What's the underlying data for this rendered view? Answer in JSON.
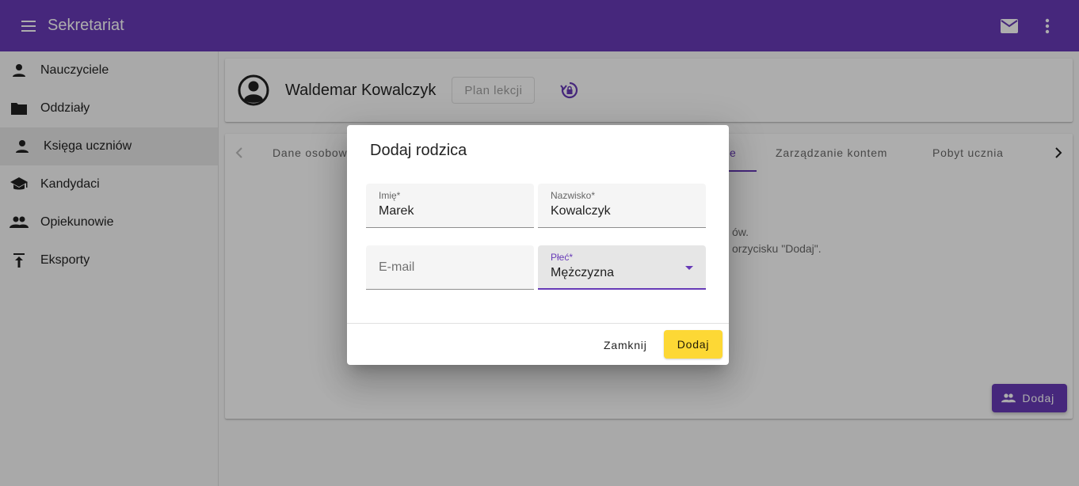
{
  "app": {
    "title": "Sekretariat"
  },
  "colors": {
    "primary": "#673ab7",
    "accent": "#fdd835"
  },
  "sidebar": {
    "items": [
      {
        "label": "Nauczyciele",
        "icon": "person-icon"
      },
      {
        "label": "Oddziały",
        "icon": "folder-icon"
      },
      {
        "label": "Księga uczniów",
        "icon": "person-icon",
        "active": true
      },
      {
        "label": "Kandydaci",
        "icon": "school-icon"
      },
      {
        "label": "Opiekunowie",
        "icon": "people-icon"
      },
      {
        "label": "Eksporty",
        "icon": "upload-icon"
      }
    ]
  },
  "profile": {
    "name": "Waldemar Kowalczyk",
    "plan_button": "Plan lekcji"
  },
  "tabs": {
    "items": [
      {
        "label": "Dane osobow"
      },
      {
        "label": "e",
        "active": true
      },
      {
        "label": "Zarządzanie kontem"
      },
      {
        "label": "Pobyt ucznia"
      }
    ],
    "content_lines": [
      "ów.",
      "orzycisku \"Dodaj\"."
    ]
  },
  "add_button": {
    "label": "Dodaj"
  },
  "dialog": {
    "title": "Dodaj rodzica",
    "fields": {
      "first_name": {
        "label": "Imię*",
        "value": "Marek"
      },
      "last_name": {
        "label": "Nazwisko*",
        "value": "Kowalczyk"
      },
      "email": {
        "placeholder": "E-mail",
        "value": ""
      },
      "gender": {
        "label": "Płeć*",
        "value": "Mężczyzna"
      }
    },
    "close_label": "Zamknij",
    "submit_label": "Dodaj"
  }
}
